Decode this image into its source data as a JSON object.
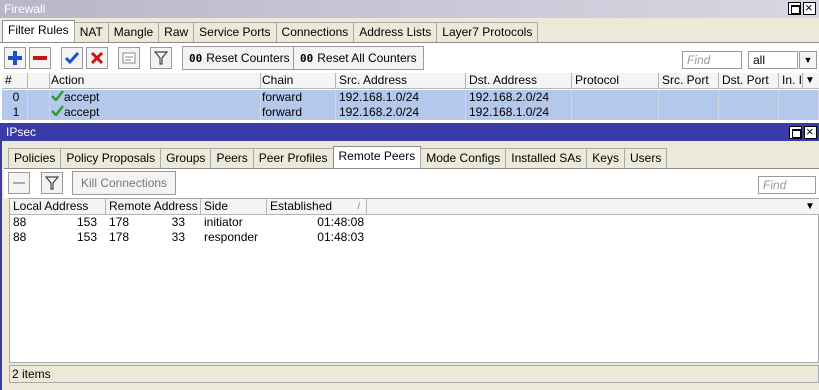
{
  "firewall": {
    "title": "Firewall",
    "tabs": [
      "Filter Rules",
      "NAT",
      "Mangle",
      "Raw",
      "Service Ports",
      "Connections",
      "Address Lists",
      "Layer7 Protocols"
    ],
    "active_tab": "Filter Rules",
    "toolbar": {
      "reset_counters": "Reset Counters",
      "reset_all_counters": "Reset All Counters",
      "counter_icon": "00",
      "find_placeholder": "Find",
      "filter_value": "all"
    },
    "columns": [
      "#",
      "Action",
      "Chain",
      "Src. Address",
      "Dst. Address",
      "Protocol",
      "Src. Port",
      "Dst. Port",
      "In. In"
    ],
    "rows": [
      {
        "num": "0",
        "action": "accept",
        "chain": "forward",
        "src": "192.168.1.0/24",
        "dst": "192.168.2.0/24"
      },
      {
        "num": "1",
        "action": "accept",
        "chain": "forward",
        "src": "192.168.2.0/24",
        "dst": "192.168.1.0/24"
      }
    ]
  },
  "ipsec": {
    "title": "IPsec",
    "tabs": [
      "Policies",
      "Policy Proposals",
      "Groups",
      "Peers",
      "Peer Profiles",
      "Remote Peers",
      "Mode Configs",
      "Installed SAs",
      "Keys",
      "Users"
    ],
    "active_tab": "Remote Peers",
    "toolbar": {
      "kill_connections": "Kill Connections",
      "find_placeholder": "Find"
    },
    "columns": [
      "Local Address",
      "Remote Address",
      "Side",
      "Established"
    ],
    "sort_indicator": "/",
    "rows": [
      {
        "local_a": "88",
        "local_b": "153",
        "remote_a": "178",
        "remote_b": "33",
        "side": "initiator",
        "established": "01:48:08"
      },
      {
        "local_a": "88",
        "local_b": "153",
        "remote_a": "178",
        "remote_b": "33",
        "side": "responder",
        "established": "01:48:03"
      }
    ],
    "status": "2 items"
  },
  "colors": {
    "ipsec_title_bg": "#3a3aa8",
    "selected_row": "#b4c8ec",
    "add_blue": "#1f4fd1",
    "remove_red": "#c81414",
    "accept_green": "#2e9d2e"
  },
  "icons": [
    "add-icon",
    "remove-icon",
    "enable-check-icon",
    "disable-x-icon",
    "comment-icon",
    "filter-icon",
    "maximize-icon",
    "close-icon",
    "dropdown-arrow-icon",
    "accept-check-icon"
  ]
}
